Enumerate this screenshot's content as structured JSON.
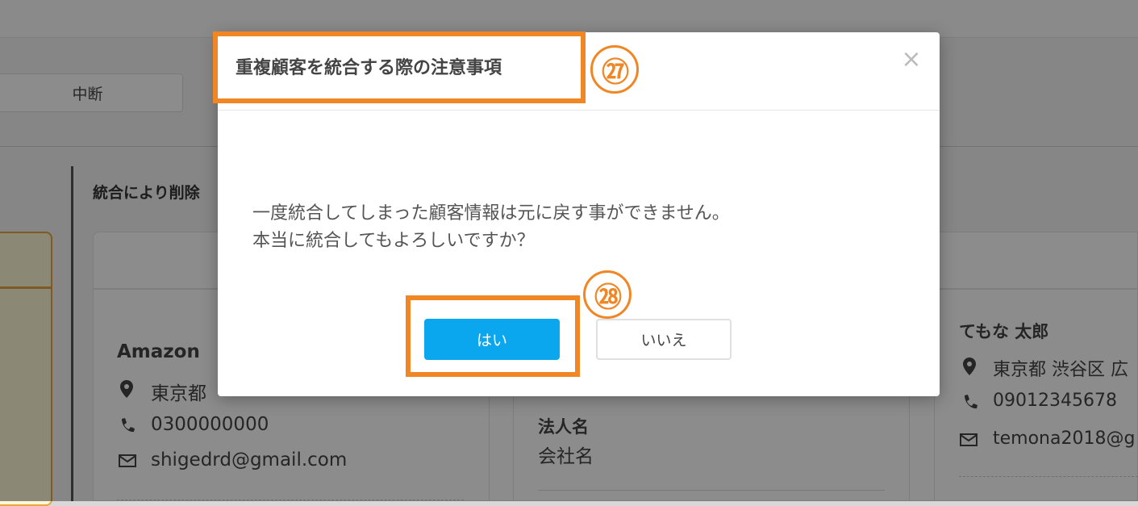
{
  "background": {
    "pause_button": "中断",
    "section_label": "統合により削除",
    "customers": [
      {
        "name": "Amazon",
        "address": "東京都",
        "phone": "0300000000",
        "email": "shigedrd@gmail.com"
      },
      {
        "corp_label": "法人名",
        "corp_value": "会社名"
      },
      {
        "name": "てもな 太郎",
        "address": "東京都 渋谷区 広",
        "phone": "09012345678",
        "email": "temona2018@g"
      }
    ]
  },
  "modal": {
    "title": "重複顧客を統合する際の注意事項",
    "close": "×",
    "message_line1": "一度統合してしまった顧客情報は元に戻す事ができません。",
    "message_line2": "本当に統合してもよろしいですか？",
    "yes_label": "はい",
    "no_label": "いいえ"
  },
  "annotations": {
    "marker_title": "㉗",
    "marker_yes": "㉘",
    "accent_color": "#f08624"
  },
  "colors": {
    "primary_button": "#0aa7ef"
  }
}
